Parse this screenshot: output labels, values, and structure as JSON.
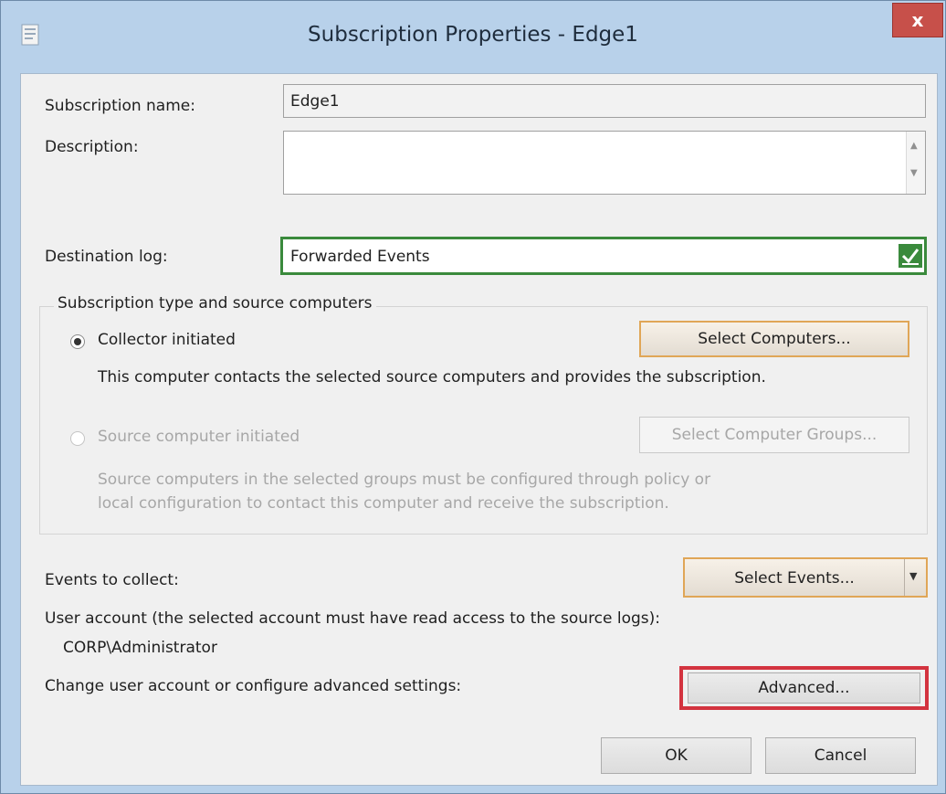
{
  "window": {
    "title": "Subscription Properties - Edge1",
    "close_label": "x",
    "icon": "subscription-app-icon"
  },
  "form": {
    "name_label": "Subscription name:",
    "name_value": "Edge1",
    "description_label": "Description:",
    "description_value": "",
    "destination_label": "Destination log:",
    "destination_value": "Forwarded Events"
  },
  "source_group": {
    "title": "Subscription type and source computers",
    "collector_label": "Collector initiated",
    "collector_selected": true,
    "collector_description": "This computer contacts the selected source computers and provides the subscription.",
    "select_computers_label": "Select Computers...",
    "source_label": "Source computer initiated",
    "source_selected": false,
    "source_description_line1": "Source computers in the selected groups must be configured through policy or",
    "source_description_line2": "local configuration to contact this computer and receive the subscription.",
    "select_groups_label": "Select Computer Groups..."
  },
  "events": {
    "label": "Events to collect:",
    "select_events_label": "Select Events..."
  },
  "account": {
    "label": "User account (the selected account must have read access to the source logs):",
    "value": "CORP\\Administrator",
    "advanced_prompt": "Change user account or configure advanced settings:",
    "advanced_label": "Advanced..."
  },
  "footer": {
    "ok_label": "OK",
    "cancel_label": "Cancel"
  },
  "colors": {
    "highlight": "#d3333f",
    "valid_border": "#3a8a3c",
    "focus_border": "#e0a657"
  }
}
